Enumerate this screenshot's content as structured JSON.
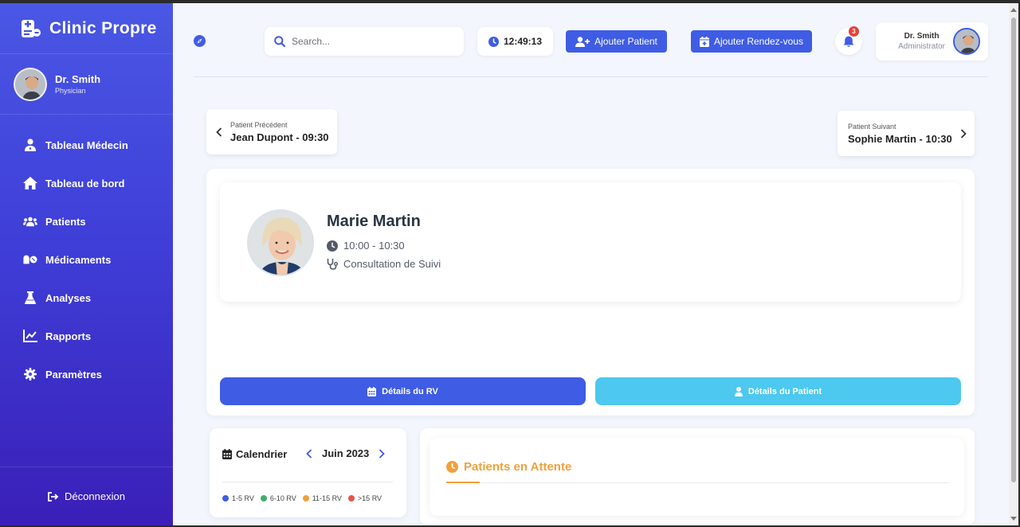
{
  "app": {
    "brand": "Clinic Propre"
  },
  "sidebar": {
    "user": {
      "name": "Dr. Smith",
      "role": "Physician"
    },
    "items": [
      {
        "label": "Tableau Médecin",
        "icon": "user-doctor-icon"
      },
      {
        "label": "Tableau de bord",
        "icon": "home-icon"
      },
      {
        "label": "Patients",
        "icon": "users-icon"
      },
      {
        "label": "Médicaments",
        "icon": "pills-icon"
      },
      {
        "label": "Analyses",
        "icon": "flask-icon"
      },
      {
        "label": "Rapports",
        "icon": "chart-line-icon"
      },
      {
        "label": "Paramètres",
        "icon": "gear-icon"
      }
    ],
    "logout": "Déconnexion"
  },
  "topbar": {
    "search_placeholder": "Search...",
    "time": "12:49:13",
    "add_patient": "Ajouter Patient",
    "add_appointment": "Ajouter Rendez-vous",
    "notification_count": "3",
    "user": {
      "name": "Dr. Smith",
      "role": "Administrator"
    }
  },
  "navigation": {
    "previous": {
      "label": "Patient Précédent",
      "value": "Jean Dupont - 09:30"
    },
    "next": {
      "label": "Patient Suivant",
      "value": "Sophie Martin - 10:30"
    }
  },
  "patient": {
    "name": "Marie Martin",
    "time": "10:00 - 10:30",
    "type": "Consultation de Suivi",
    "appointment_details": "Détails du RV",
    "patient_details": "Détails du Patient"
  },
  "calendar": {
    "title": "Calendrier",
    "month": "Juin 2023",
    "legend": [
      {
        "label": "1-5 RV",
        "color": "#3f5ce4"
      },
      {
        "label": "6-10 RV",
        "color": "#3fae6a"
      },
      {
        "label": "11-15 RV",
        "color": "#f0a13c"
      },
      {
        "label": ">15 RV",
        "color": "#e5534b"
      }
    ]
  },
  "waiting": {
    "title": "Patients en Attente"
  },
  "colors": {
    "primary": "#3f5ce4",
    "info": "#4dc8ee",
    "warning": "#f0a13c",
    "danger": "#e5413b"
  }
}
